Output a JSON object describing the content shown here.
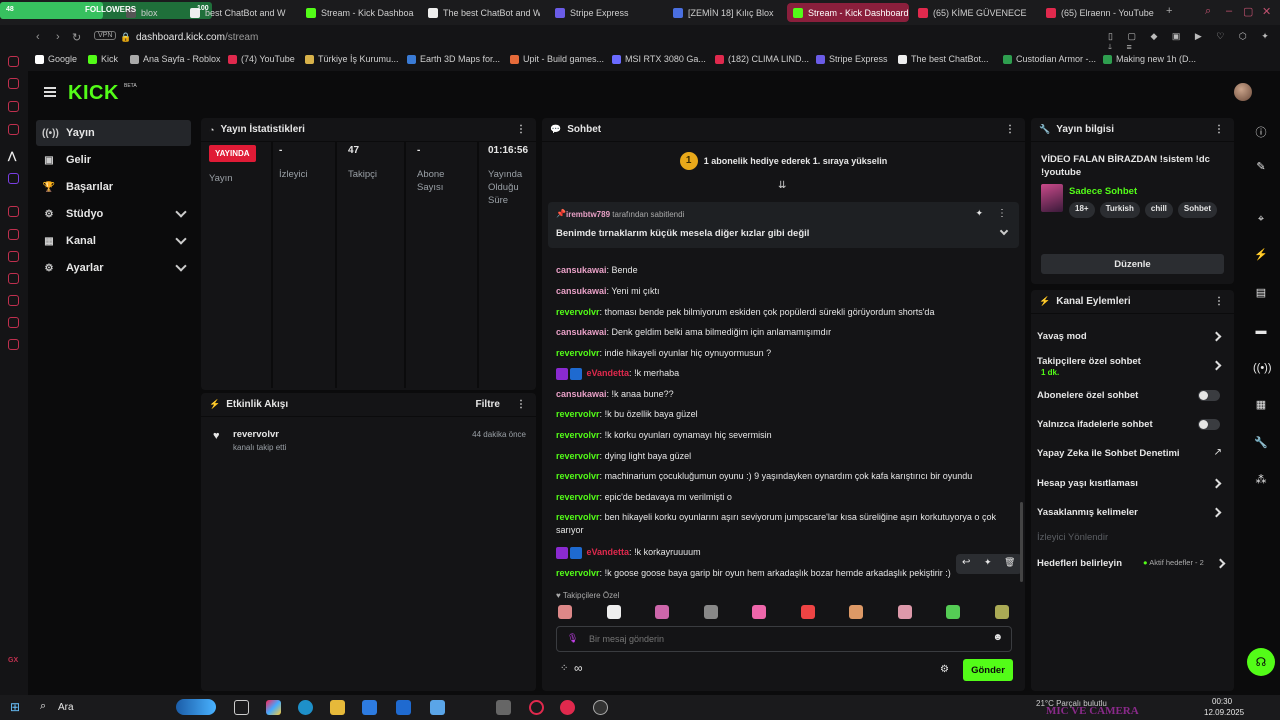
{
  "browser": {
    "followers_label": "FOLLOWERS",
    "followers_left": "48",
    "followers_count": "100",
    "tabs": [
      {
        "label": "blox",
        "color": "#555"
      },
      {
        "label": "best ChatBot and W",
        "color": "#eee"
      },
      {
        "label": "Stream - Kick Dashboar",
        "color": "#53fc18"
      },
      {
        "label": "The best ChatBot and W",
        "color": "#eee"
      },
      {
        "label": "Stripe Express",
        "color": "#6b5ce7"
      },
      {
        "label": "[ZEMİN 18] Kılıç Blox",
        "color": "#4a6fe0"
      },
      {
        "label": "Stream - Kick Dashboard",
        "color": "#53fc18"
      },
      {
        "label": "(65) KİME GÜVENECE",
        "color": "#e0294d"
      },
      {
        "label": "(65) Elraenn - YouTube",
        "color": "#e0294d"
      }
    ],
    "vpn": "VPN",
    "url_domain": "dashboard.kick.com",
    "url_path": "/stream",
    "bookmarks": [
      {
        "label": "Google",
        "color": "#ffffff"
      },
      {
        "label": "Kick",
        "color": "#53fc18"
      },
      {
        "label": "Ana Sayfa - Roblox",
        "color": "#aaaaaa"
      },
      {
        "label": "(74) YouTube",
        "color": "#e0294d"
      },
      {
        "label": "Türkiye İş Kurumu...",
        "color": "#d8b24a"
      },
      {
        "label": "Earth 3D Maps for...",
        "color": "#3a7bd5"
      },
      {
        "label": "Upit - Build games...",
        "color": "#e66b3a"
      },
      {
        "label": "MSI RTX 3080 Ga...",
        "color": "#6a6aff"
      },
      {
        "label": "(182) CLIMA LIND...",
        "color": "#e0294d"
      },
      {
        "label": "Stripe Express",
        "color": "#6b5ce7"
      },
      {
        "label": "The best ChatBot...",
        "color": "#eeeeee"
      },
      {
        "label": "Custodian Armor -...",
        "color": "#2e9e4f"
      },
      {
        "label": "Making new 1h (D...",
        "color": "#2e9e4f"
      }
    ]
  },
  "app": {
    "logo": "KICK",
    "beta": "BETA",
    "nav": [
      {
        "label": "Yayın",
        "icon": "((•))",
        "active": true,
        "chevron": false
      },
      {
        "label": "Gelir",
        "icon": "▣",
        "active": false,
        "chevron": false
      },
      {
        "label": "Başarılar",
        "icon": "🏆",
        "active": false,
        "chevron": false
      },
      {
        "label": "Stüdyo",
        "icon": "⚙",
        "active": false,
        "chevron": true
      },
      {
        "label": "Kanal",
        "icon": "▦",
        "active": false,
        "chevron": true
      },
      {
        "label": "Ayarlar",
        "icon": "⚙",
        "active": false,
        "chevron": true
      }
    ]
  },
  "stats": {
    "title": "Yayın İstatistikleri",
    "live_badge": "YAYINDA",
    "live_label": "Yayın",
    "cells": [
      {
        "value": "-",
        "label": "İzleyici"
      },
      {
        "value": "47",
        "label": "Takipçi"
      },
      {
        "value": "-",
        "label": "Abone Sayısı"
      },
      {
        "value": "01:16:56",
        "label": "Yayında Olduğu Süre"
      }
    ]
  },
  "activity": {
    "title": "Etkinlik Akışı",
    "filter": "Filtre",
    "items": [
      {
        "user": "revervolvr",
        "action": "kanalı takip etti",
        "time": "44 dakika önce"
      }
    ]
  },
  "chat": {
    "title": "Sohbet",
    "gift_num": "1",
    "gift_text": "1 abonelik hediye ederek 1. sıraya yükselin",
    "pinned_by_user": "irembtw789",
    "pinned_by_suffix": "tarafından sabitlendi",
    "pinned_text": "Benimde tırnaklarım küçük mesela diğer kızlar gibi değil",
    "messages": [
      {
        "user": "cansukawai",
        "text": "Bende",
        "style": "pink"
      },
      {
        "user": "cansukawai",
        "text": "Yeni mi çıktı",
        "style": "pink"
      },
      {
        "user": "revervolvr",
        "text": "thoması bende pek bilmiyorum eskiden çok popülerdi sürekli görüyordum shorts'da",
        "style": "green"
      },
      {
        "user": "cansukawai",
        "text": "Denk geldim belki ama bilmediğim için anlamamışımdır",
        "style": "pink"
      },
      {
        "user": "revervolvr",
        "text": "indie hikayeli oyunlar hiç oynuyormusun ?",
        "style": "green"
      },
      {
        "user": "eVandetta",
        "text": "!k merhaba",
        "style": "red"
      },
      {
        "user": "cansukawai",
        "text": "!k anaa bune??",
        "style": "pink"
      },
      {
        "user": "revervolvr",
        "text": "!k bu özellik baya güzel",
        "style": "green"
      },
      {
        "user": "revervolvr",
        "text": "!k korku oyunları oynamayı hiç severmisin",
        "style": "green"
      },
      {
        "user": "revervolvr",
        "text": "dying light baya güzel",
        "style": "green"
      },
      {
        "user": "revervolvr",
        "text": "machinarium çocukluğumun oyunu :) 9 yaşındayken oynardım çok kafa karıştırıcı bir oyundu",
        "style": "green"
      },
      {
        "user": "revervolvr",
        "text": "epic'de bedavaya mı verilmişti o",
        "style": "green"
      },
      {
        "user": "revervolvr",
        "text": "ben hikayeli korku oyunlarını aşırı seviyorum jumpscare'lar kısa süreliğine aşırı korkutuyorya o çok sarıyor",
        "style": "green"
      },
      {
        "user": "eVandetta",
        "text": "!k korkayruuuum",
        "style": "red"
      },
      {
        "user": "revervolvr",
        "text": "!k goose goose baya garip bir oyun hem arkadaşlık bozar hemde arkadaşlık pekiştirir :)",
        "style": "green"
      }
    ],
    "followers_only": "Takipçilere Özel",
    "input_placeholder": "Bir mesaj gönderin",
    "infinity": "∞",
    "send": "Gönder"
  },
  "stream_info": {
    "title": "Yayın bilgisi",
    "stream_title": "VİDEO FALAN BİRAZDAN !sistem !dc !youtube",
    "category": "Sadece Sohbet",
    "tags": [
      "18+",
      "Turkish",
      "chill",
      "Sohbet"
    ],
    "edit": "Düzenle"
  },
  "channel_actions": {
    "title": "Kanal Eylemleri",
    "slow_mode": "Yavaş mod",
    "followers_only": "Takipçilere özel sohbet",
    "followers_sub": "1 dk.",
    "subs_only": "Abonelere özel sohbet",
    "emote_only": "Yalnızca ifadelerle sohbet",
    "ai_mod": "Yapay Zeka ile Sohbet Denetimi",
    "account_age": "Hesap yaşı kısıtlaması",
    "banned_words": "Yasaklanmış kelimeler",
    "viewer_redirect": "İzleyici Yönlendir",
    "goals": "Hedefleri belirleyin",
    "goals_status": "Aktif hedefler - 2"
  },
  "taskbar": {
    "search": "Ara",
    "weather": "21°C  Parçalı bulutlu",
    "time": "00:30",
    "date": "12.09.2025",
    "overlay": "MIC VE CAMERA"
  },
  "colors": {
    "kick_green": "#53fc18",
    "live_red": "#e01b36",
    "panel_bg": "#141416",
    "app_bg": "#0b0b0c"
  }
}
